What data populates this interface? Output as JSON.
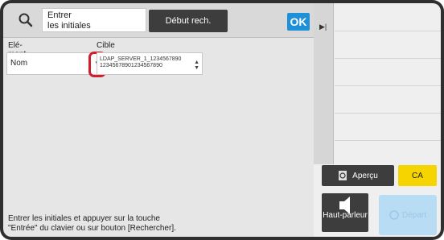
{
  "search": {
    "icon": "search-icon",
    "field_label": "Entrer\nles initiales",
    "start_button": "Début rech.",
    "ok_button": "OK"
  },
  "form": {
    "element_label": "Elé-\nment",
    "element_value": "Nom",
    "target_label": "Cible",
    "target_value": "LDAP_SERVER_1_1234567890\n12345678901234567890"
  },
  "hint": "Entrer les initiales et appuyer sur la touche\n\"Entrée\" du clavier ou sur bouton [Rechercher].",
  "side": {
    "preview_button": "Aperçu",
    "ca_button": "CA",
    "speaker_label": "Haut-parleur",
    "start_button": "Départ"
  },
  "colors": {
    "accent": "#1e90d8",
    "highlight": "#d0202e",
    "ca": "#f5d400"
  }
}
